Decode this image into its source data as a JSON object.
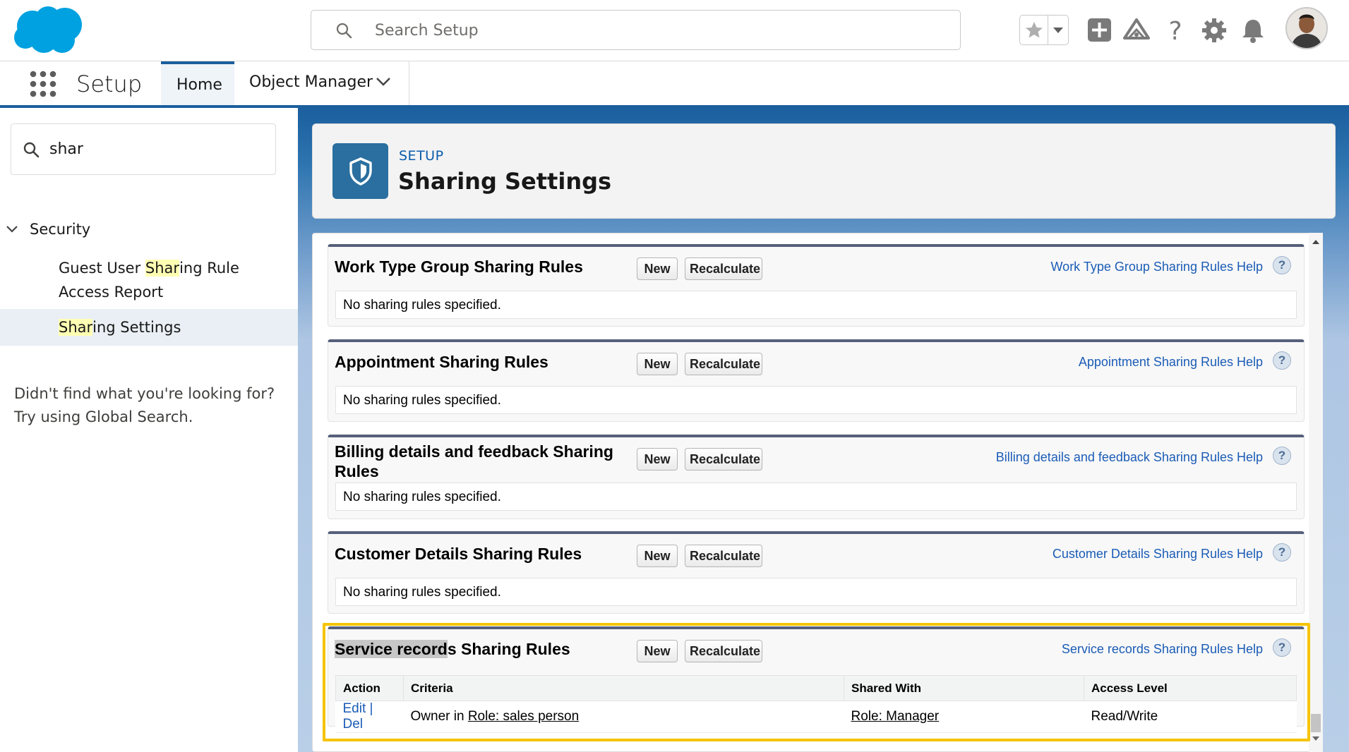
{
  "header": {
    "search_placeholder": "Search Setup",
    "icons": [
      "salesforce-cloud-logo",
      "star-icon",
      "chevron-down-icon",
      "add-icon",
      "trailhead-icon",
      "help-icon",
      "gear-icon",
      "bell-icon",
      "user-avatar"
    ]
  },
  "nav": {
    "app_name": "Setup",
    "tabs": [
      {
        "label": "Home",
        "active": true
      },
      {
        "label": "Object Manager",
        "active": false
      }
    ]
  },
  "sidebar": {
    "quickfind_value": "shar",
    "section": "Security",
    "items": [
      {
        "pre": "Guest User ",
        "match": "Shar",
        "post": "ing Rule Access Report"
      },
      {
        "pre": "",
        "match": "Shar",
        "post": "ing Settings",
        "selected": true
      }
    ],
    "not_found_line1": "Didn't find what you're looking for?",
    "not_found_line2": "Try using Global Search."
  },
  "page": {
    "kicker": "SETUP",
    "title": "Sharing Settings"
  },
  "buttons": {
    "new": "New",
    "recalculate": "Recalculate"
  },
  "help_glyph": "?",
  "sections": [
    {
      "title": "Work Type Group Sharing Rules",
      "help": "Work Type Group Sharing Rules Help",
      "empty": "No sharing rules specified."
    },
    {
      "title": "Appointment Sharing Rules",
      "help": "Appointment Sharing Rules Help",
      "empty": "No sharing rules specified."
    },
    {
      "title": "Billing details and feedback Sharing Rules",
      "help": "Billing details and feedback Sharing Rules Help",
      "empty": "No sharing rules specified."
    },
    {
      "title": "Customer Details Sharing Rules",
      "help": "Customer Details Sharing Rules Help",
      "empty": "No sharing rules specified."
    },
    {
      "title_highlight": "Service record",
      "title_rest": "s Sharing Rules",
      "help": "Service records Sharing Rules Help"
    }
  ],
  "rules_table": {
    "headers": [
      "Action",
      "Criteria",
      "Shared With",
      "Access Level"
    ],
    "row": {
      "edit": "Edit",
      "separator": "|",
      "del": "Del",
      "criteria_prefix": "Owner in ",
      "criteria_link": "Role: sales person",
      "shared_with": "Role: Manager",
      "access_level": "Read/Write"
    }
  },
  "colors": {
    "brand_blue": "#1b5f9e",
    "link_blue": "#1b5cb6",
    "highlight_yellow": "#f5c400",
    "salesforce_cloud": "#00a1e0"
  }
}
